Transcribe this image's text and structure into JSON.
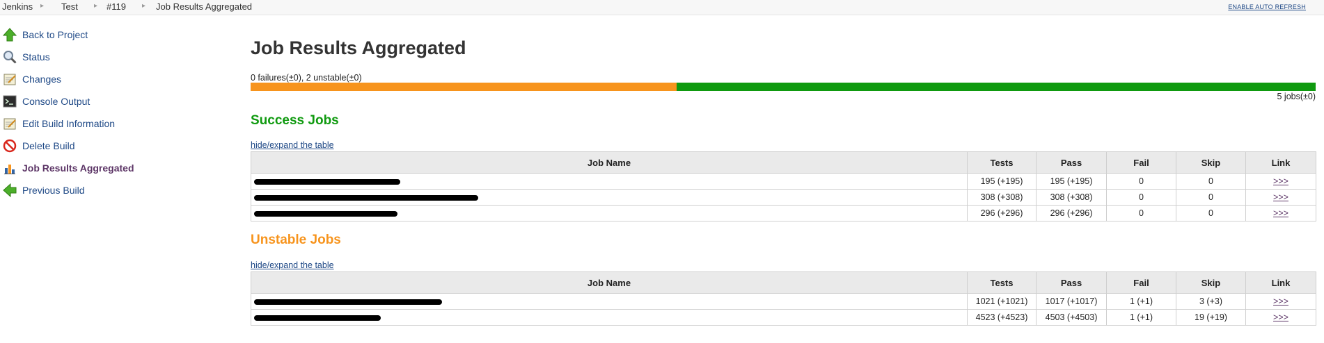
{
  "breadcrumbs": [
    "Jenkins",
    "Test",
    "#119",
    "Job Results Aggregated"
  ],
  "header": {
    "auto_refresh": "ENABLE AUTO REFRESH"
  },
  "sidebar": {
    "items": [
      {
        "label": "Back to Project",
        "icon": "up-arrow-icon"
      },
      {
        "label": "Status",
        "icon": "search-icon"
      },
      {
        "label": "Changes",
        "icon": "notepad-icon"
      },
      {
        "label": "Console Output",
        "icon": "terminal-icon"
      },
      {
        "label": "Edit Build Information",
        "icon": "notepad-icon"
      },
      {
        "label": "Delete Build",
        "icon": "no-entry-icon"
      },
      {
        "label": "Job Results Aggregated",
        "icon": "bar-chart-icon",
        "active": true
      },
      {
        "label": "Previous Build",
        "icon": "left-arrow-icon"
      }
    ]
  },
  "main": {
    "title": "Job Results Aggregated",
    "summary": "0 failures(±0), 2 unstable(±0)",
    "jobs_count": "5 jobs(±0)",
    "bar": {
      "unstable_fraction": 0.4,
      "stable_fraction": 0.6
    },
    "colors": {
      "unstable": "#f7941d",
      "success": "#0f9a0f",
      "link": "#204a87"
    },
    "success": {
      "title": "Success Jobs",
      "toggle": "hide/expand the table",
      "columns": [
        "Job Name",
        "Tests",
        "Pass",
        "Fail",
        "Skip",
        "Link"
      ],
      "rows": [
        {
          "tests": "195 (+195)",
          "pass": "195 (+195)",
          "fail": "0",
          "skip": "0",
          "link": ">>>"
        },
        {
          "tests": "308 (+308)",
          "pass": "308 (+308)",
          "fail": "0",
          "skip": "0",
          "link": ">>>"
        },
        {
          "tests": "296 (+296)",
          "pass": "296 (+296)",
          "fail": "0",
          "skip": "0",
          "link": ">>>"
        }
      ]
    },
    "unstable": {
      "title": "Unstable Jobs",
      "toggle": "hide/expand the table",
      "columns": [
        "Job Name",
        "Tests",
        "Pass",
        "Fail",
        "Skip",
        "Link"
      ],
      "rows": [
        {
          "tests": "1021 (+1021)",
          "pass": "1017 (+1017)",
          "fail": "1 (+1)",
          "skip": "3 (+3)",
          "link": ">>>"
        },
        {
          "tests": "4523 (+4523)",
          "pass": "4503 (+4503)",
          "fail": "1 (+1)",
          "skip": "19 (+19)",
          "link": ">>>"
        }
      ]
    }
  }
}
